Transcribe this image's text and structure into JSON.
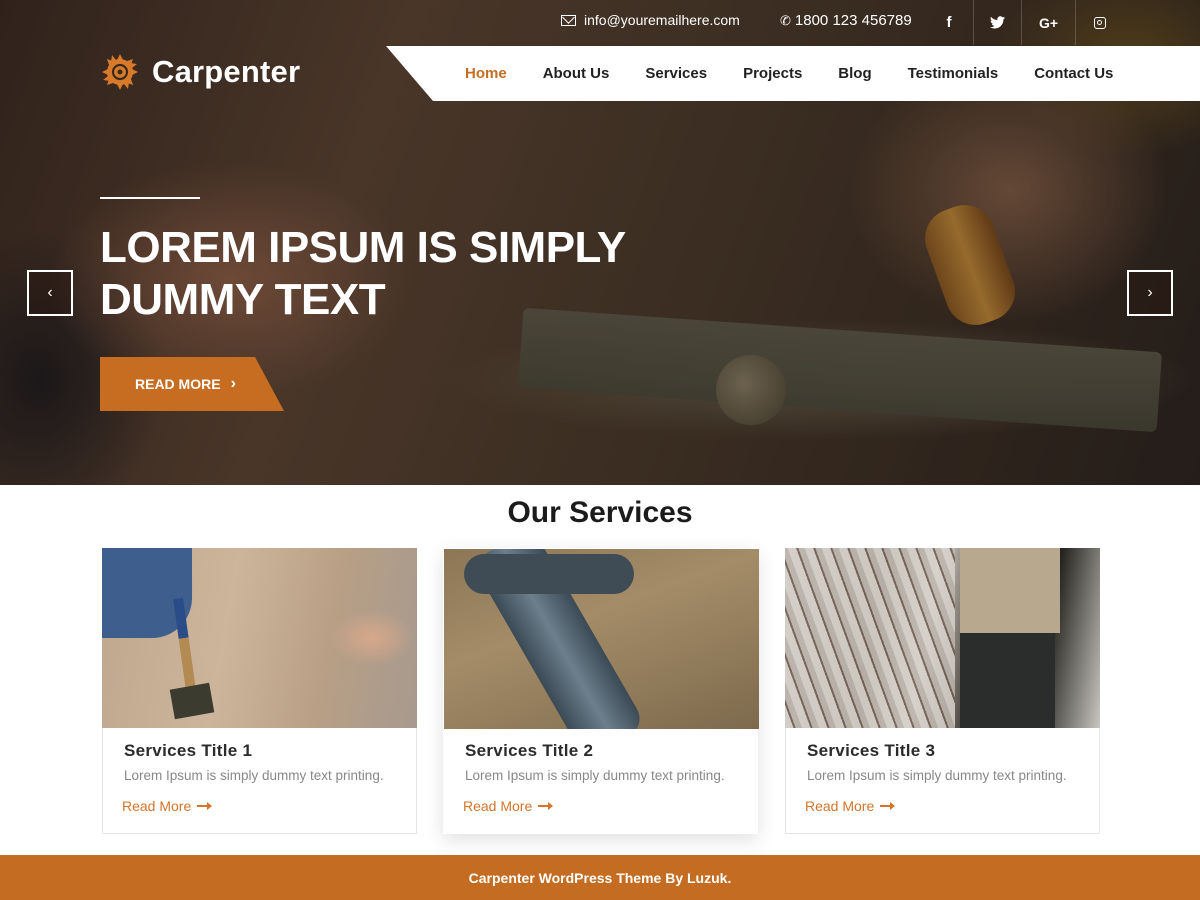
{
  "topbar": {
    "email": "info@youremailhere.com",
    "phone": "1800 123 456789",
    "social": [
      {
        "name": "facebook",
        "glyph": "f"
      },
      {
        "name": "twitter",
        "glyph": "🐦"
      },
      {
        "name": "google-plus",
        "glyph": "G+"
      },
      {
        "name": "instagram",
        "glyph": ""
      }
    ]
  },
  "logo": {
    "text": "Carpenter",
    "icon": "saw-blade-icon"
  },
  "nav": {
    "items": [
      "Home",
      "About Us",
      "Services",
      "Projects",
      "Blog",
      "Testimonials",
      "Contact Us"
    ],
    "active": "Home"
  },
  "hero": {
    "title": "LOREM IPSUM IS SIMPLY DUMMY TEXT",
    "button_label": "READ MORE",
    "button_chevron": "›",
    "prev_arrow": "‹",
    "next_arrow": "›"
  },
  "services": {
    "heading": "Our Services",
    "cards": [
      {
        "title": "Services Title 1",
        "text": "Lorem Ipsum is simply dummy text printing.",
        "link": "Read More"
      },
      {
        "title": "Services Title 2",
        "text": "Lorem Ipsum is simply dummy text printing.",
        "link": "Read More"
      },
      {
        "title": "Services Title 3",
        "text": "Lorem Ipsum is simply dummy text printing.",
        "link": "Read More"
      }
    ]
  },
  "footer": {
    "text": "Carpenter WordPress Theme By Luzuk."
  },
  "colors": {
    "accent": "#c66d22",
    "footer": "#c36c22",
    "link": "#d6742a"
  }
}
